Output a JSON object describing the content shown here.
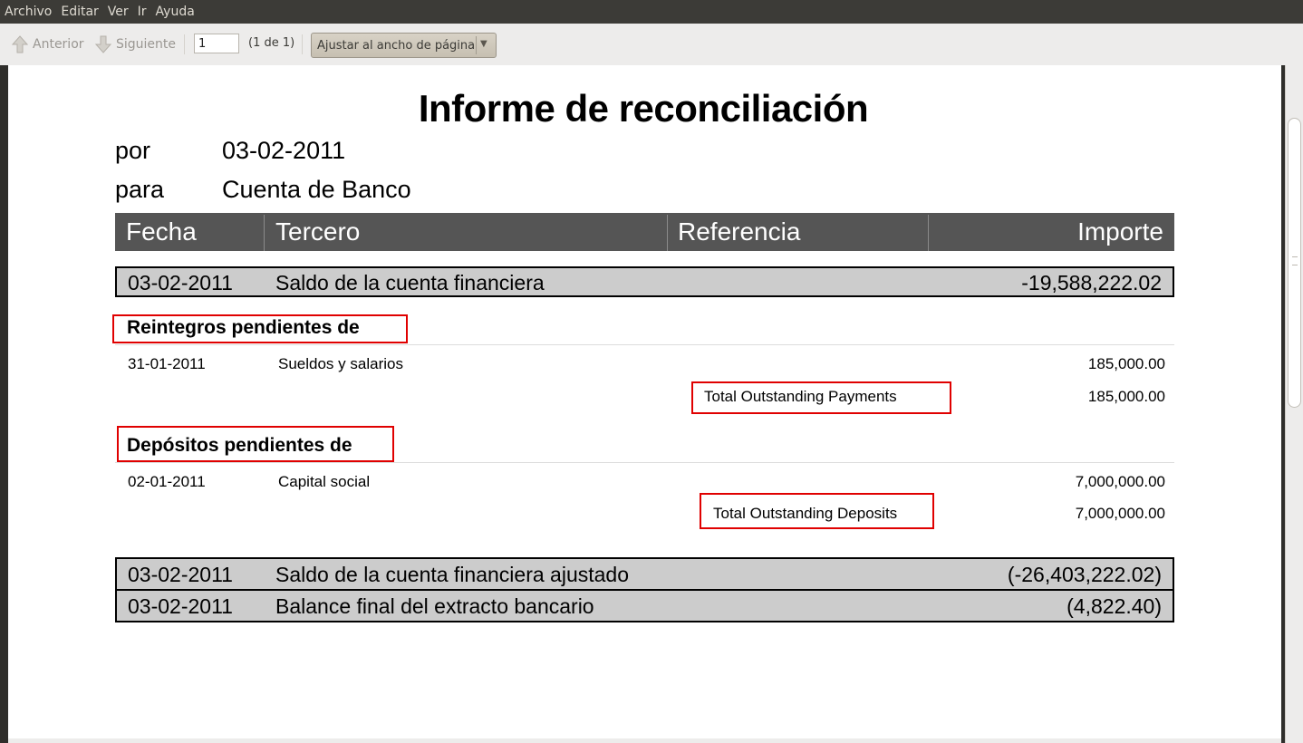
{
  "menu": [
    "Archivo",
    "Editar",
    "Ver",
    "Ir",
    "Ayuda"
  ],
  "toolbar": {
    "prev_label": "Anterior",
    "next_label": "Siguiente",
    "page_value": "1",
    "page_count": "(1 de 1)",
    "zoom_label": "Ajustar al ancho de página"
  },
  "report": {
    "title": "Informe de reconciliación",
    "por_label": "por",
    "por_value": "03-02-2011",
    "para_label": "para",
    "para_value": "Cuenta de Banco",
    "columns": [
      "Fecha",
      "Tercero",
      "Referencia",
      "Importe"
    ],
    "opening": {
      "date": "03-02-2011",
      "desc": "Saldo de la cuenta financiera",
      "amount": "-19,588,222.02"
    },
    "payments": {
      "heading": "Reintegros pendientes de",
      "rows": [
        {
          "date": "31-01-2011",
          "desc": "Sueldos y salarios",
          "amount": "185,000.00"
        }
      ],
      "total_label": "Total Outstanding Payments",
      "total_amount": "185,000.00"
    },
    "deposits": {
      "heading": "Depósitos pendientes de",
      "rows": [
        {
          "date": "02-01-2011",
          "desc": "Capital social",
          "amount": "7,000,000.00"
        }
      ],
      "total_label": "Total Outstanding Deposits",
      "total_amount": "7,000,000.00"
    },
    "adjusted": {
      "date": "03-02-2011",
      "desc": "Saldo de la cuenta financiera ajustado",
      "amount": "(-26,403,222.02)"
    },
    "statement": {
      "date": "03-02-2011",
      "desc": "Balance final del extracto bancario",
      "amount": "(4,822.40)"
    }
  },
  "colors": {
    "header_bg": "#555555",
    "row_bg": "#cccccc",
    "highlight": "#e00000",
    "menubar_bg": "#3c3b37"
  }
}
